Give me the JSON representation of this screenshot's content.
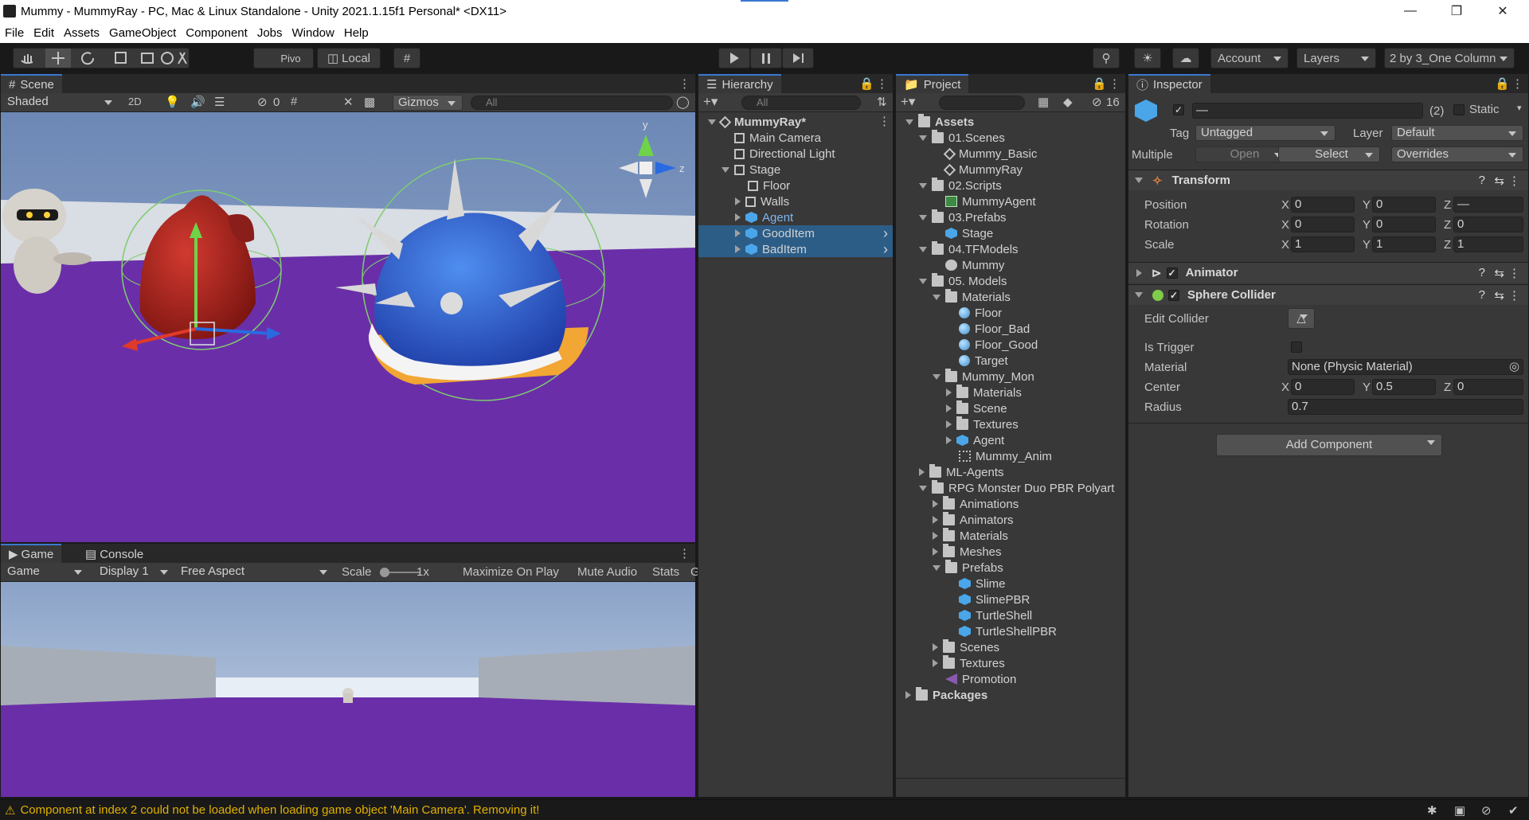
{
  "window": {
    "title": "Mummy - MummyRay - PC, Mac & Linux Standalone - Unity 2021.1.15f1 Personal* <DX11>",
    "minimize": "—",
    "maximize": "❐",
    "close": "✕"
  },
  "menu": [
    "File",
    "Edit",
    "Assets",
    "GameObject",
    "Component",
    "Jobs",
    "Window",
    "Help"
  ],
  "toolbar": {
    "pivot": "Pivo",
    "local": "Local",
    "account": "Account",
    "layers": "Layers",
    "layout": "2 by 3_One Column"
  },
  "scene": {
    "tab": "Scene",
    "shading": "Shaded",
    "mode2d": "2D",
    "hidden_count": "0",
    "gizmos": "Gizmos",
    "search_placeholder": "All",
    "axis_y": "y",
    "axis_z": "z"
  },
  "game": {
    "tab_game": "Game",
    "tab_console": "Console",
    "view": "Game",
    "display": "Display 1",
    "aspect": "Free Aspect",
    "scale_label": "Scale",
    "scale_value": "1x",
    "maximize": "Maximize On Play",
    "mute": "Mute Audio",
    "stats": "Stats",
    "gizmos_cut": "G"
  },
  "hierarchy": {
    "tab": "Hierarchy",
    "search_placeholder": "All",
    "items": [
      {
        "label": "MummyRay*",
        "depth": 0,
        "arrow": "down",
        "icon": "scene",
        "bold": true
      },
      {
        "label": "Main Camera",
        "depth": 1,
        "arrow": "none",
        "icon": "cube"
      },
      {
        "label": "Directional Light",
        "depth": 1,
        "arrow": "none",
        "icon": "cube"
      },
      {
        "label": "Stage",
        "depth": 1,
        "arrow": "down",
        "icon": "cube"
      },
      {
        "label": "Floor",
        "depth": 2,
        "arrow": "none",
        "icon": "cube"
      },
      {
        "label": "Walls",
        "depth": 2,
        "arrow": "right",
        "icon": "cube"
      },
      {
        "label": "Agent",
        "depth": 2,
        "arrow": "right",
        "icon": "prefab",
        "color": "#7fb4f0"
      },
      {
        "label": "GoodItem",
        "depth": 2,
        "arrow": "right",
        "icon": "prefab",
        "selected": true
      },
      {
        "label": "BadItem",
        "depth": 2,
        "arrow": "right",
        "icon": "prefab",
        "selected": true
      }
    ]
  },
  "project": {
    "tab": "Project",
    "hidden_count": "16",
    "items": [
      {
        "label": "Assets",
        "depth": 0,
        "arrow": "down",
        "icon": "folder",
        "bold": true
      },
      {
        "label": "01.Scenes",
        "depth": 1,
        "arrow": "down",
        "icon": "folder"
      },
      {
        "label": "Mummy_Basic",
        "depth": 2,
        "arrow": "none",
        "icon": "scene"
      },
      {
        "label": "MummyRay",
        "depth": 2,
        "arrow": "none",
        "icon": "scene"
      },
      {
        "label": "02.Scripts",
        "depth": 1,
        "arrow": "down",
        "icon": "folder"
      },
      {
        "label": "MummyAgent",
        "depth": 2,
        "arrow": "none",
        "icon": "script"
      },
      {
        "label": "03.Prefabs",
        "depth": 1,
        "arrow": "down",
        "icon": "folder"
      },
      {
        "label": "Stage",
        "depth": 2,
        "arrow": "none",
        "icon": "prefab"
      },
      {
        "label": "04.TFModels",
        "depth": 1,
        "arrow": "down",
        "icon": "folder"
      },
      {
        "label": "Mummy",
        "depth": 2,
        "arrow": "none",
        "icon": "model"
      },
      {
        "label": "05. Models",
        "depth": 1,
        "arrow": "down",
        "icon": "folder"
      },
      {
        "label": "Materials",
        "depth": 2,
        "arrow": "down",
        "icon": "folder"
      },
      {
        "label": "Floor",
        "depth": 3,
        "arrow": "none",
        "icon": "mat"
      },
      {
        "label": "Floor_Bad",
        "depth": 3,
        "arrow": "none",
        "icon": "mat"
      },
      {
        "label": "Floor_Good",
        "depth": 3,
        "arrow": "none",
        "icon": "mat"
      },
      {
        "label": "Target",
        "depth": 3,
        "arrow": "none",
        "icon": "mat"
      },
      {
        "label": "Mummy_Mon",
        "depth": 2,
        "arrow": "down",
        "icon": "folder"
      },
      {
        "label": "Materials",
        "depth": 3,
        "arrow": "right",
        "icon": "folder"
      },
      {
        "label": "Scene",
        "depth": 3,
        "arrow": "right",
        "icon": "folder"
      },
      {
        "label": "Textures",
        "depth": 3,
        "arrow": "right",
        "icon": "folder"
      },
      {
        "label": "Agent",
        "depth": 3,
        "arrow": "right",
        "icon": "prefab"
      },
      {
        "label": "Mummy_Anim",
        "depth": 3,
        "arrow": "none",
        "icon": "anim"
      },
      {
        "label": "ML-Agents",
        "depth": 1,
        "arrow": "right",
        "icon": "folder"
      },
      {
        "label": "RPG Monster Duo PBR Polyart",
        "depth": 1,
        "arrow": "down",
        "icon": "folder"
      },
      {
        "label": "Animations",
        "depth": 2,
        "arrow": "right",
        "icon": "folder"
      },
      {
        "label": "Animators",
        "depth": 2,
        "arrow": "right",
        "icon": "folder"
      },
      {
        "label": "Materials",
        "depth": 2,
        "arrow": "right",
        "icon": "folder"
      },
      {
        "label": "Meshes",
        "depth": 2,
        "arrow": "right",
        "icon": "folder"
      },
      {
        "label": "Prefabs",
        "depth": 2,
        "arrow": "down",
        "icon": "folder"
      },
      {
        "label": "Slime",
        "depth": 3,
        "arrow": "none",
        "icon": "prefab"
      },
      {
        "label": "SlimePBR",
        "depth": 3,
        "arrow": "none",
        "icon": "prefab"
      },
      {
        "label": "TurtleShell",
        "depth": 3,
        "arrow": "none",
        "icon": "prefab"
      },
      {
        "label": "TurtleShellPBR",
        "depth": 3,
        "arrow": "none",
        "icon": "prefab"
      },
      {
        "label": "Scenes",
        "depth": 2,
        "arrow": "right",
        "icon": "folder"
      },
      {
        "label": "Textures",
        "depth": 2,
        "arrow": "right",
        "icon": "folder"
      },
      {
        "label": "Promotion",
        "depth": 2,
        "arrow": "none",
        "icon": "promo"
      },
      {
        "label": "Packages",
        "depth": 0,
        "arrow": "right",
        "icon": "folder",
        "bold": true
      }
    ]
  },
  "inspector": {
    "tab": "Inspector",
    "name_value": "—",
    "count": "(2)",
    "static_label": "Static",
    "tag_label": "Tag",
    "tag_value": "Untagged",
    "layer_label": "Layer",
    "layer_value": "Default",
    "multiple_label": "Multiple",
    "open_label": "Open",
    "select_label": "Select",
    "overrides_label": "Overrides",
    "transform": {
      "title": "Transform",
      "position_label": "Position",
      "pos_x": "0",
      "pos_y": "0",
      "pos_z": "—",
      "rotation_label": "Rotation",
      "rot_x": "0",
      "rot_y": "0",
      "rot_z": "0",
      "scale_label": "Scale",
      "scale_x": "1",
      "scale_y": "1",
      "scale_z": "1",
      "x": "X",
      "y": "Y",
      "z": "Z"
    },
    "animator": {
      "title": "Animator"
    },
    "sphere_collider": {
      "title": "Sphere Collider",
      "edit_label": "Edit Collider",
      "trigger_label": "Is Trigger",
      "material_label": "Material",
      "material_value": "None (Physic Material)",
      "center_label": "Center",
      "center_x": "0",
      "center_y": "0.5",
      "center_z": "0",
      "radius_label": "Radius",
      "radius_value": "0.7"
    },
    "add_component": "Add Component"
  },
  "status": {
    "message": "Component at index 2 could not be loaded when loading game object 'Main Camera'. Removing it!"
  },
  "colors": {
    "accent": "#3a78d0",
    "selection": "#2c5d87",
    "warning": "#e0b000",
    "floor_purple": "#6a2fa8"
  }
}
